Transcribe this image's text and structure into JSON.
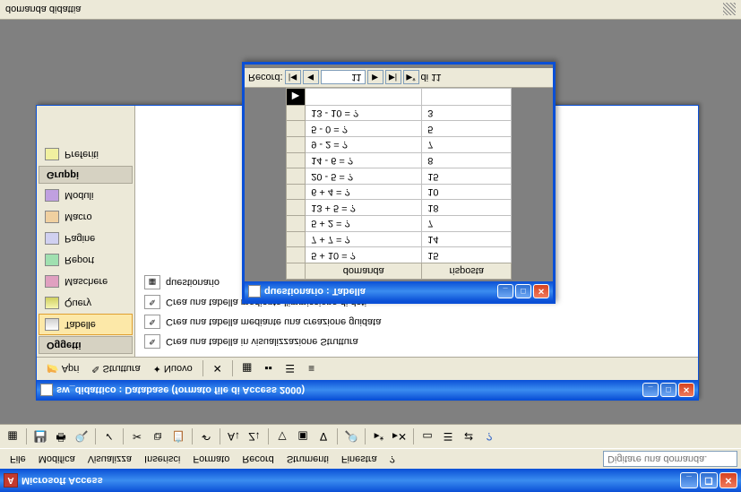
{
  "app": {
    "title": "Microsoft Access",
    "menu": [
      "File",
      "Modifica",
      "Visualizza",
      "Inserisci",
      "Formato",
      "Record",
      "Strumenti",
      "Finestra",
      "?"
    ],
    "help_placeholder": "Digitare una domanda."
  },
  "dbwin": {
    "title": "sw_didattico : Database (formato file di Access 2000)",
    "tb": {
      "apri": "Apri",
      "struttura": "Struttura",
      "nuovo": "Nuovo"
    },
    "side_hdr1": "Oggetti",
    "side_hdr2": "Gruppi",
    "side": {
      "tabelle": "Tabelle",
      "query": "Query",
      "maschere": "Maschere",
      "report": "Report",
      "pagine": "Pagine",
      "macro": "Macro",
      "moduli": "Moduli",
      "preferiti": "Preferiti"
    },
    "objs": [
      "Crea una tabella in visualizzazione Struttura",
      "Crea una tabella mediante una creazione guidata",
      "Crea una tabella mediante l'immissione di dati",
      "questionario"
    ]
  },
  "tablewin": {
    "title": "questionario : Tabella",
    "cols": [
      "domanda",
      "risposta"
    ],
    "rows": [
      {
        "d": "5 + 10 = ?",
        "r": "15"
      },
      {
        "d": "7 + 7 = ?",
        "r": "14"
      },
      {
        "d": "5 + 2 = ?",
        "r": "7"
      },
      {
        "d": "13 + 5 = ?",
        "r": "18"
      },
      {
        "d": "6 + 4 = ?",
        "r": "10"
      },
      {
        "d": "20 - 5 = ?",
        "r": "15"
      },
      {
        "d": "14 - 6 = ?",
        "r": "8"
      },
      {
        "d": "9 - 2 = ?",
        "r": "7"
      },
      {
        "d": "5 - 0 = ?",
        "r": "5"
      },
      {
        "d": "13 - 10 = ?",
        "r": "3"
      }
    ],
    "rec": {
      "label": "Record:",
      "cur": "11",
      "of": "di 11"
    }
  },
  "status": "domanda didattia"
}
